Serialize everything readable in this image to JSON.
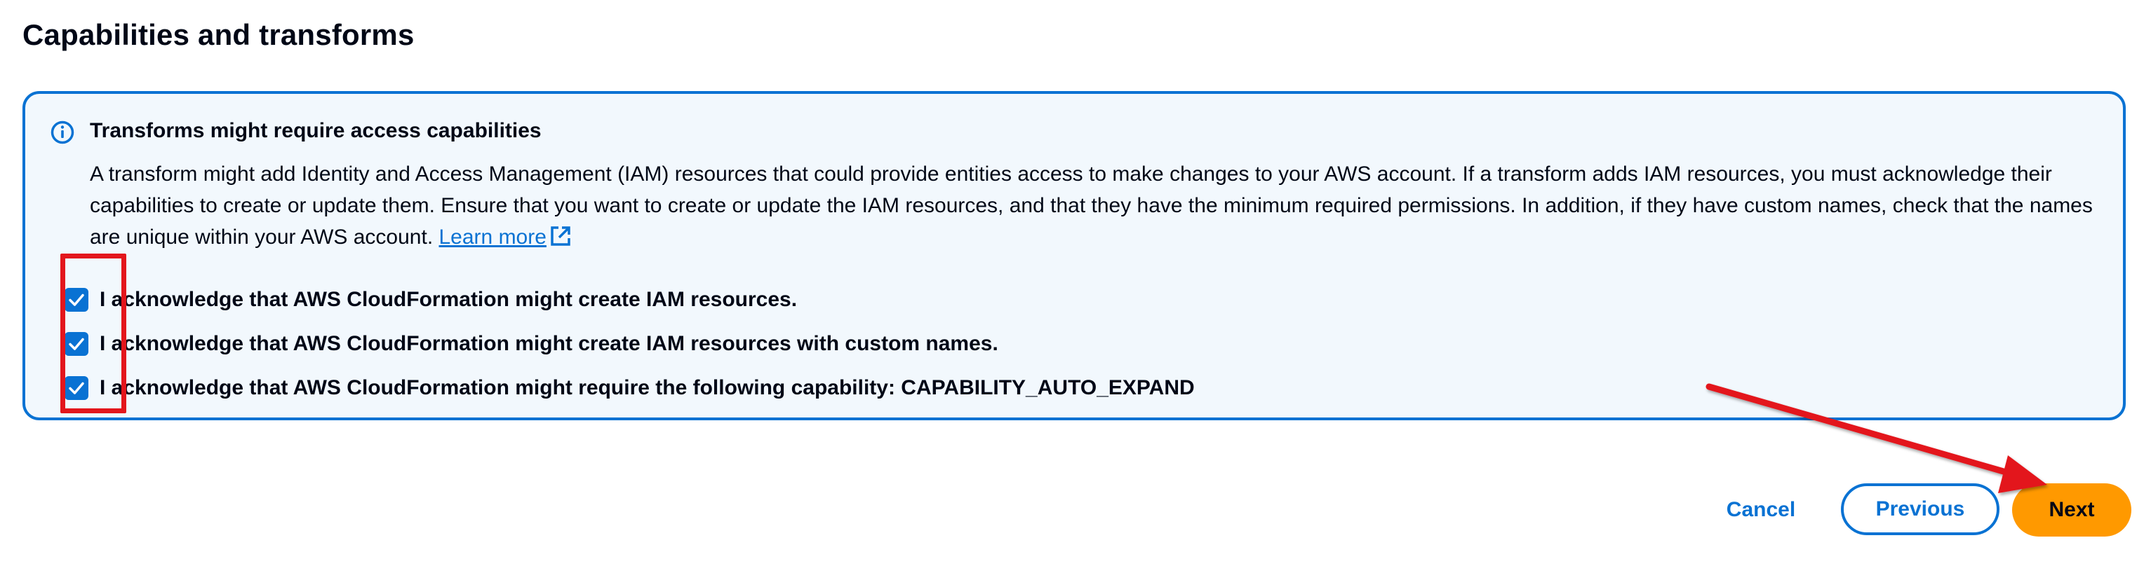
{
  "section": {
    "title": "Capabilities and transforms"
  },
  "info_panel": {
    "icon": "info-icon",
    "heading": "Transforms might require access capabilities",
    "body_text": "A transform might add Identity and Access Management (IAM) resources that could provide entities access to make changes to your AWS account. If a transform adds IAM resources, you must acknowledge their capabilities to create or update them. Ensure that you want to create or update the IAM resources, and that they have the minimum required permissions. In addition, if they have custom names, check that the names are unique within your AWS account.",
    "learn_more_label": "Learn more",
    "learn_more_icon": "external-link-icon",
    "accent_color": "#0972d3",
    "background_color": "#f2f8fd"
  },
  "acknowledgements": [
    {
      "label": "I acknowledge that AWS CloudFormation might create IAM resources.",
      "checked": true
    },
    {
      "label": "I acknowledge that AWS CloudFormation might create IAM resources with custom names.",
      "checked": true
    },
    {
      "label": "I acknowledge that AWS CloudFormation might require the following capability: CAPABILITY_AUTO_EXPAND",
      "checked": true
    }
  ],
  "actions": {
    "cancel_label": "Cancel",
    "previous_label": "Previous",
    "next_label": "Next",
    "primary_color": "#ff9900"
  },
  "annotation": {
    "highlight_color": "#e3161c"
  }
}
